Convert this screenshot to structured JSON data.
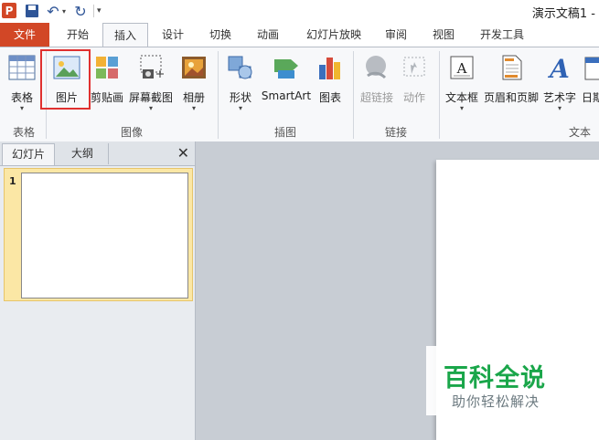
{
  "app": {
    "title": "演示文稿1 -"
  },
  "quick_access": {
    "logo": "P",
    "undo_glyph": "↶",
    "redo_glyph": "↻",
    "dropdown_glyph": "▾",
    "more_glyph": "▾"
  },
  "tabs": [
    {
      "label": "文件"
    },
    {
      "label": "开始"
    },
    {
      "label": "插入"
    },
    {
      "label": "设计"
    },
    {
      "label": "切换"
    },
    {
      "label": "动画"
    },
    {
      "label": "幻灯片放映"
    },
    {
      "label": "审阅"
    },
    {
      "label": "视图"
    },
    {
      "label": "开发工具"
    }
  ],
  "ribbon": {
    "buttons": [
      {
        "label": "表格",
        "icon": "table-icon",
        "has_dropdown": true
      },
      {
        "label": "图片",
        "icon": "picture-icon",
        "has_dropdown": false
      },
      {
        "label": "剪贴画",
        "icon": "clipart-icon",
        "has_dropdown": false
      },
      {
        "label": "屏幕截图",
        "icon": "screenshot-icon",
        "has_dropdown": true
      },
      {
        "label": "相册",
        "icon": "album-icon",
        "has_dropdown": true
      },
      {
        "label": "形状",
        "icon": "shapes-icon",
        "has_dropdown": true
      },
      {
        "label": "SmartArt",
        "icon": "smartart-icon",
        "has_dropdown": false
      },
      {
        "label": "图表",
        "icon": "chart-icon",
        "has_dropdown": false
      },
      {
        "label": "超链接",
        "icon": "hyperlink-icon",
        "has_dropdown": false,
        "disabled": true
      },
      {
        "label": "动作",
        "icon": "action-icon",
        "has_dropdown": false,
        "disabled": true
      },
      {
        "label": "文本框",
        "icon": "textbox-icon",
        "has_dropdown": true
      },
      {
        "label": "页眉和页脚",
        "icon": "header-footer-icon",
        "has_dropdown": false
      },
      {
        "label": "艺术字",
        "icon": "wordart-icon",
        "has_dropdown": true
      },
      {
        "label": "日期",
        "icon": "date-icon",
        "has_dropdown": false
      }
    ],
    "groups": [
      {
        "label": "表格"
      },
      {
        "label": "图像"
      },
      {
        "label": "插图"
      },
      {
        "label": "链接"
      },
      {
        "label": "文本"
      }
    ],
    "dropdown_glyph": "▾"
  },
  "left_pane": {
    "tabs": [
      {
        "label": "幻灯片"
      },
      {
        "label": "大纲"
      }
    ],
    "close_glyph": "✕",
    "slides": [
      {
        "number": "1"
      }
    ]
  },
  "watermark": {
    "main": "百科全说",
    "sub": "助你轻松解决"
  },
  "colors": {
    "file_tab": "#d24726",
    "highlight": "#e0302f",
    "watermark_green": "#1aa64a",
    "slide_selected": "#fbe7a5"
  }
}
